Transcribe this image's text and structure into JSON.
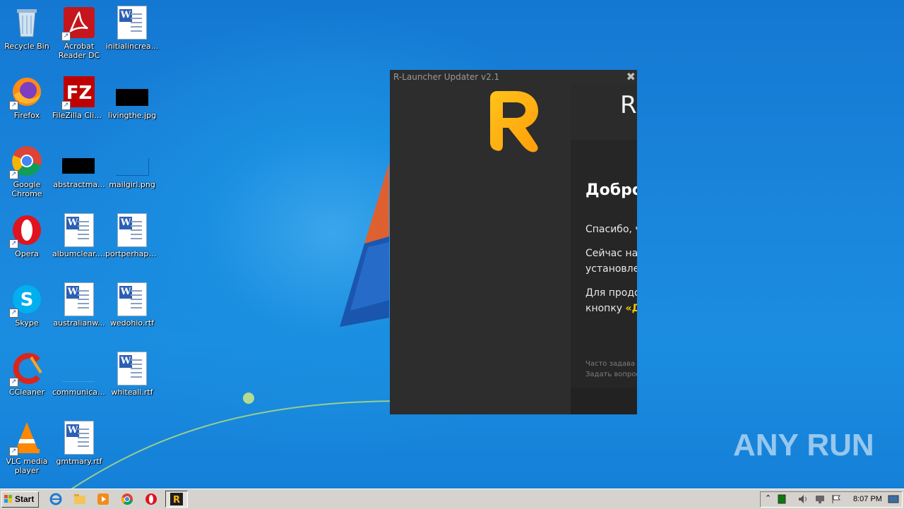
{
  "desktop": {
    "icons": [
      {
        "label": "Recycle Bin",
        "icon": "recycle-bin-icon"
      },
      {
        "label": "Acrobat Reader DC",
        "icon": "acrobat-icon"
      },
      {
        "label": "initialincrea...",
        "icon": "word-doc-icon"
      },
      {
        "label": "Firefox",
        "icon": "firefox-icon"
      },
      {
        "label": "FileZilla Client",
        "icon": "filezilla-icon"
      },
      {
        "label": "livingthe.jpg",
        "icon": "image-file-icon"
      },
      {
        "label": "Google Chrome",
        "icon": "chrome-icon"
      },
      {
        "label": "abstractma...",
        "icon": "image-file-icon"
      },
      {
        "label": "mailgirl.png",
        "icon": "image-file-icon"
      },
      {
        "label": "Opera",
        "icon": "opera-icon"
      },
      {
        "label": "albumclear.rtf",
        "icon": "word-doc-icon"
      },
      {
        "label": "portperhaps...",
        "icon": "word-doc-icon"
      },
      {
        "label": "Skype",
        "icon": "skype-icon"
      },
      {
        "label": "australianw...",
        "icon": "word-doc-icon"
      },
      {
        "label": "wedohio.rtf",
        "icon": "word-doc-icon"
      },
      {
        "label": "CCleaner",
        "icon": "ccleaner-icon"
      },
      {
        "label": "communicati...",
        "icon": "file-icon"
      },
      {
        "label": "whiteall.rtf",
        "icon": "word-doc-icon"
      },
      {
        "label": "VLC media player",
        "icon": "vlc-icon"
      },
      {
        "label": "gmtmary.rtf",
        "icon": "word-doc-icon"
      }
    ],
    "watermark": "ANY RUN"
  },
  "updater": {
    "title": "R-Launcher Updater v2.1",
    "close_glyph": "✖",
    "header_letter": "R",
    "welcome": "Добро",
    "para1": "Спасибо, ч",
    "para2_line1": "Сейчас на",
    "para2_line2": "установле",
    "para3_line1": "Для продо",
    "para3_line2_prefix": "кнопку ",
    "para3_line2_highlight": "«Д",
    "faq": "Часто задава",
    "ask": "Задать вопрос",
    "accent_color": "#f7c600"
  },
  "taskbar": {
    "start_label": "Start",
    "clock": "8:07 PM"
  }
}
